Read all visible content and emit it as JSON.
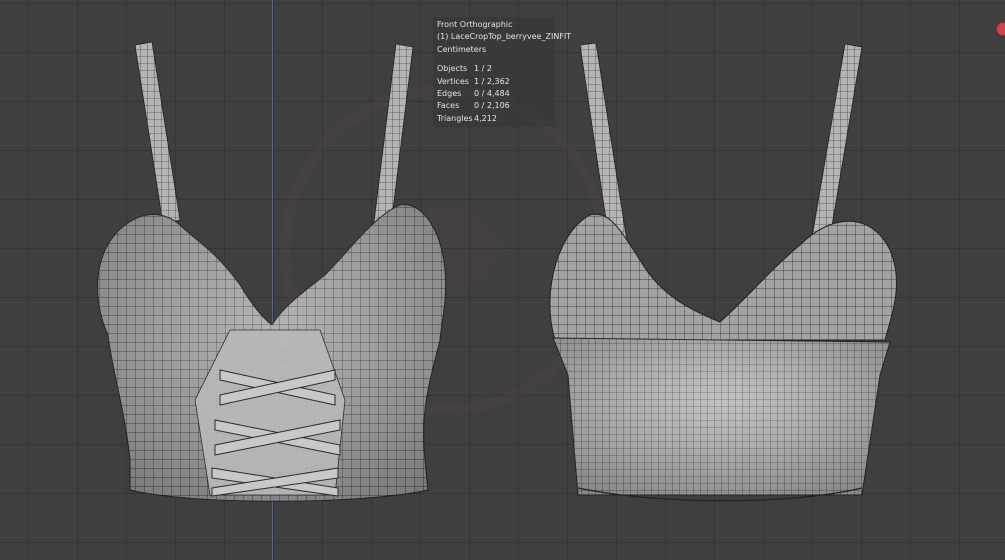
{
  "viewport": {
    "view_name": "Front Orthographic",
    "object_name": "(1) LaceCropTop_berryvee_ZINFIT",
    "units": "Centimeters",
    "stats": [
      {
        "key": "Objects",
        "value": "1 / 2"
      },
      {
        "key": "Vertices",
        "value": "1 / 2,362"
      },
      {
        "key": "Edges",
        "value": "0 / 4,484"
      },
      {
        "key": "Faces",
        "value": "0 / 2,106"
      },
      {
        "key": "Triangles",
        "value": "4,212"
      }
    ]
  },
  "colors": {
    "background": "#3f3f3f",
    "grid": "#353535",
    "mesh_fill": "#9a9a9a",
    "mesh_wire": "#1f1f1f",
    "z_axis": "#4b6fa8",
    "gizmo": "#c6464d"
  },
  "icons": {
    "navigation_gizmo": "red-axis-dot-icon",
    "watermark": "logo-watermark"
  }
}
